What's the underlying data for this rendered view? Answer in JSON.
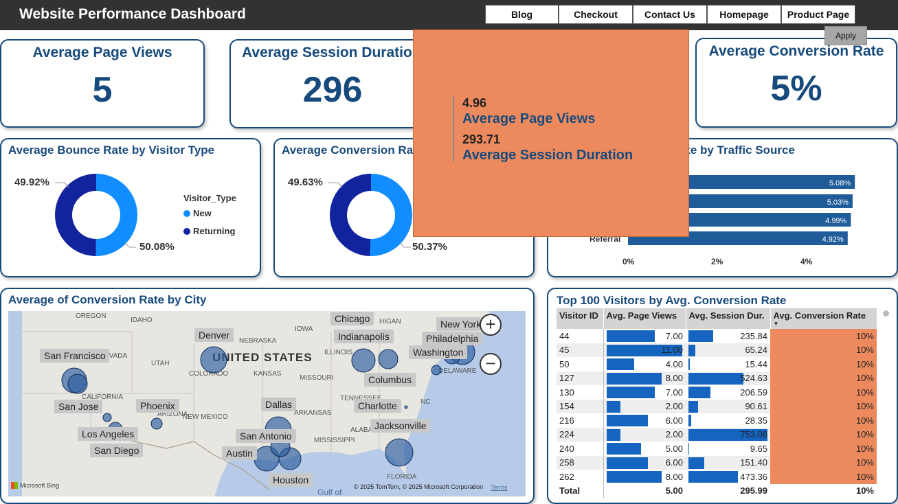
{
  "header": {
    "title": "Website Performance Dashboard"
  },
  "page_tabs": [
    "Blog",
    "Checkout",
    "Contact Us",
    "Homepage",
    "Product Page"
  ],
  "apply_label": "Apply",
  "kpis": {
    "page_views": {
      "title": "Average Page Views",
      "value": "5"
    },
    "session_duration": {
      "title": "Average Session Duration",
      "value": "296"
    },
    "conversion_rate": {
      "title": "Average Conversion Rate",
      "value": "5%"
    }
  },
  "tooltip": {
    "page_views_value": "4.96",
    "page_views_label": "Average Page Views",
    "session_value": "293.71",
    "session_label": "Average Session Duration"
  },
  "bounce_chart": {
    "title": "Average Bounce Rate by Visitor Type",
    "legend_title": "Visitor_Type",
    "legend": [
      "New",
      "Returning"
    ],
    "label_returning": "49.92%",
    "label_new": "50.08%"
  },
  "conversion_visitor_chart": {
    "title": "Average Conversion Rate by Visitor Type",
    "label_returning": "49.63%",
    "label_new": "50.37%"
  },
  "traffic_chart": {
    "title": "Average Conversion Rate by Traffic Source",
    "visible_category": "Referral",
    "bar_labels": [
      "5.08%",
      "5.03%",
      "4.99%",
      "4.92%"
    ],
    "ticks": [
      "0%",
      "2%",
      "4%"
    ]
  },
  "chart_data": [
    {
      "type": "pie",
      "title": "Average Bounce Rate by Visitor Type",
      "categories": [
        "New",
        "Returning"
      ],
      "values": [
        50.08,
        49.92
      ],
      "legend": "right"
    },
    {
      "type": "pie",
      "title": "Average Conversion Rate by Visitor Type",
      "categories": [
        "New",
        "Returning"
      ],
      "values": [
        50.37,
        49.63
      ]
    },
    {
      "type": "bar",
      "title": "Average Conversion Rate by Traffic Source",
      "categories": [
        "",
        "",
        "",
        "Referral"
      ],
      "values": [
        5.08,
        5.03,
        4.99,
        4.92
      ],
      "xlim": [
        0,
        6
      ]
    }
  ],
  "map_card": {
    "title": "Average of Conversion Rate by City",
    "cities": [
      "Chicago",
      "New York",
      "Denver",
      "Indianapolis",
      "Philadelphia",
      "San Francisco",
      "Washington",
      "Columbus",
      "San Jose",
      "Phoenix",
      "Dallas",
      "Charlotte",
      "Los Angeles",
      "Jacksonville",
      "San Antonio",
      "San Diego",
      "Austin",
      "Houston"
    ],
    "country_label": "UNITED STATES",
    "states": [
      "OREGON",
      "IDAHO",
      "NEBRASKA",
      "IOWA",
      "ILLINOIS",
      "UTAH",
      "COLORADO",
      "KANSAS",
      "MISSOURI",
      "CALIFORNIA",
      "ARIZONA",
      "NEW MEXICO",
      "ARKANSAS",
      "TENNESSEE",
      "MISSISSIPPI",
      "ALABAMA",
      "FLORIDA",
      "NC",
      "DELAWARE",
      "EVADA",
      "HIGAN"
    ],
    "attribution": "© 2025 TomTom, © 2025 Microsoft Corporation",
    "terms": "Terms",
    "bing": "Microsoft Bing",
    "gulf": "Gulf of",
    "zoom_in": "+",
    "zoom_out": "−"
  },
  "visitors_table": {
    "title": "Top 100 Visitors by Avg. Conversion Rate",
    "columns": [
      "Visitor ID",
      "Avg. Page Views",
      "Avg. Session Dur.",
      "Avg. Conversion Rate"
    ],
    "rows": [
      {
        "id": "44",
        "pv": "7.00",
        "sd": "235.84",
        "cr": "10%",
        "pvn": 7,
        "sdn": 235.84
      },
      {
        "id": "45",
        "pv": "11.00",
        "sd": "65.24",
        "cr": "10%",
        "pvn": 11,
        "sdn": 65.24
      },
      {
        "id": "50",
        "pv": "4.00",
        "sd": "15.44",
        "cr": "10%",
        "pvn": 4,
        "sdn": 15.44
      },
      {
        "id": "127",
        "pv": "8.00",
        "sd": "524.63",
        "cr": "10%",
        "pvn": 8,
        "sdn": 524.63
      },
      {
        "id": "130",
        "pv": "7.00",
        "sd": "206.59",
        "cr": "10%",
        "pvn": 7,
        "sdn": 206.59
      },
      {
        "id": "154",
        "pv": "2.00",
        "sd": "90.61",
        "cr": "10%",
        "pvn": 2,
        "sdn": 90.61
      },
      {
        "id": "216",
        "pv": "6.00",
        "sd": "28.35",
        "cr": "10%",
        "pvn": 6,
        "sdn": 28.35
      },
      {
        "id": "224",
        "pv": "2.00",
        "sd": "753.06",
        "cr": "10%",
        "pvn": 2,
        "sdn": 753.06
      },
      {
        "id": "240",
        "pv": "5.00",
        "sd": "9.65",
        "cr": "10%",
        "pvn": 5,
        "sdn": 9.65
      },
      {
        "id": "258",
        "pv": "6.00",
        "sd": "151.40",
        "cr": "10%",
        "pvn": 6,
        "sdn": 151.4
      },
      {
        "id": "262",
        "pv": "8.00",
        "sd": "473.36",
        "cr": "10%",
        "pvn": 8,
        "sdn": 473.36
      }
    ],
    "total": {
      "label": "Total",
      "pv": "5.00",
      "sd": "295.99",
      "cr": "10%"
    }
  },
  "colors": {
    "new": "#118dff",
    "returning": "#12239e",
    "bar": "#1565c0",
    "header": "#323232",
    "accent": "#174a7c",
    "highlight": "#ec8a5e"
  }
}
